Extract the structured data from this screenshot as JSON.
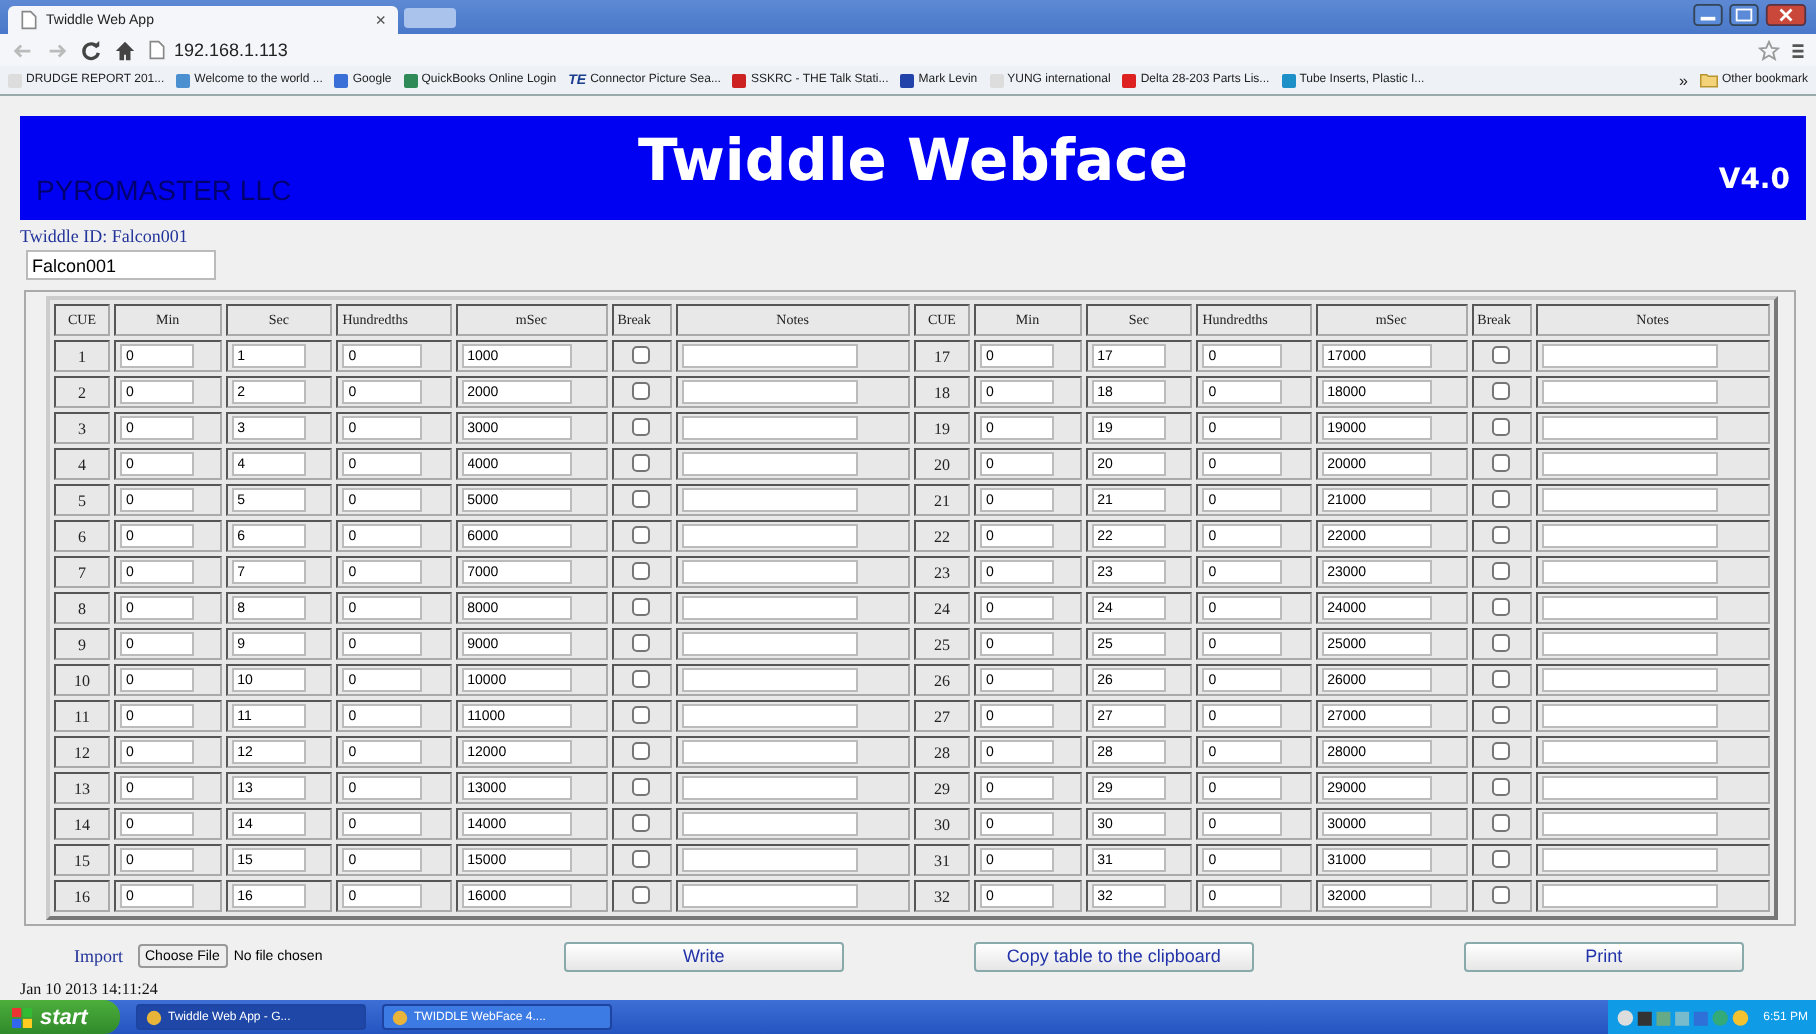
{
  "browser": {
    "tab": {
      "title": "Twiddle Web App",
      "close": "×"
    },
    "address": "192.168.1.113",
    "bookmarks": [
      {
        "label": "DRUDGE REPORT 201...",
        "color": "#dddddd"
      },
      {
        "label": "Welcome to the world ...",
        "color": "#4a8fd0"
      },
      {
        "label": "Google",
        "color": "#3a6fd8"
      },
      {
        "label": "QuickBooks Online Login",
        "color": "#2e8b57"
      },
      {
        "label": "Connector Picture Sea...",
        "color": "#1b3f8f",
        "badge": "TE"
      },
      {
        "label": "SSKRC - THE Talk Stati...",
        "color": "#cc2222"
      },
      {
        "label": "Mark Levin",
        "color": "#2244aa"
      },
      {
        "label": "YUNG international",
        "color": "#dddddd"
      },
      {
        "label": "Delta 28-203 Parts Lis...",
        "color": "#dd2222"
      },
      {
        "label": "Tube Inserts, Plastic I...",
        "color": "#1e90c8"
      }
    ],
    "overflow": "»",
    "other_bookmarks": "Other bookmark"
  },
  "header": {
    "company": "PYROMASTER LLC",
    "title": "Twiddle Webface",
    "version": "V4.0"
  },
  "twiddle_id": {
    "label": "Twiddle ID: Falcon001",
    "value": "Falcon001"
  },
  "table": {
    "halves": [
      {
        "columns": [
          "CUE",
          "Min",
          "Sec",
          "Hundredths",
          "mSec",
          "Break",
          "Notes"
        ],
        "cues": [
          {
            "cue": "1",
            "min": "0",
            "sec": "1",
            "hundredths": "0",
            "msec": "1000",
            "break": false
          },
          {
            "cue": "2",
            "min": "0",
            "sec": "2",
            "hundredths": "0",
            "msec": "2000",
            "break": false
          },
          {
            "cue": "3",
            "min": "0",
            "sec": "3",
            "hundredths": "0",
            "msec": "3000",
            "break": false
          },
          {
            "cue": "4",
            "min": "0",
            "sec": "4",
            "hundredths": "0",
            "msec": "4000",
            "break": false
          },
          {
            "cue": "5",
            "min": "0",
            "sec": "5",
            "hundredths": "0",
            "msec": "5000",
            "break": false
          },
          {
            "cue": "6",
            "min": "0",
            "sec": "6",
            "hundredths": "0",
            "msec": "6000",
            "break": false
          },
          {
            "cue": "7",
            "min": "0",
            "sec": "7",
            "hundredths": "0",
            "msec": "7000",
            "break": false
          },
          {
            "cue": "8",
            "min": "0",
            "sec": "8",
            "hundredths": "0",
            "msec": "8000",
            "break": false
          },
          {
            "cue": "9",
            "min": "0",
            "sec": "9",
            "hundredths": "0",
            "msec": "9000",
            "break": false
          },
          {
            "cue": "10",
            "min": "0",
            "sec": "10",
            "hundredths": "0",
            "msec": "10000",
            "break": false
          },
          {
            "cue": "11",
            "min": "0",
            "sec": "11",
            "hundredths": "0",
            "msec": "11000",
            "break": false
          },
          {
            "cue": "12",
            "min": "0",
            "sec": "12",
            "hundredths": "0",
            "msec": "12000",
            "break": false
          },
          {
            "cue": "13",
            "min": "0",
            "sec": "13",
            "hundredths": "0",
            "msec": "13000",
            "break": false
          },
          {
            "cue": "14",
            "min": "0",
            "sec": "14",
            "hundredths": "0",
            "msec": "14000",
            "break": false
          },
          {
            "cue": "15",
            "min": "0",
            "sec": "15",
            "hundredths": "0",
            "msec": "15000",
            "break": false
          },
          {
            "cue": "16",
            "min": "0",
            "sec": "16",
            "hundredths": "0",
            "msec": "16000",
            "break": false
          }
        ]
      },
      {
        "columns": [
          "CUE",
          "Min",
          "Sec",
          "Hundredths",
          "mSec",
          "Break",
          "Notes"
        ],
        "cues": [
          {
            "cue": "17",
            "min": "0",
            "sec": "17",
            "hundredths": "0",
            "msec": "17000",
            "break": false
          },
          {
            "cue": "18",
            "min": "0",
            "sec": "18",
            "hundredths": "0",
            "msec": "18000",
            "break": false
          },
          {
            "cue": "19",
            "min": "0",
            "sec": "19",
            "hundredths": "0",
            "msec": "19000",
            "break": false
          },
          {
            "cue": "20",
            "min": "0",
            "sec": "20",
            "hundredths": "0",
            "msec": "20000",
            "break": false
          },
          {
            "cue": "21",
            "min": "0",
            "sec": "21",
            "hundredths": "0",
            "msec": "21000",
            "break": false
          },
          {
            "cue": "22",
            "min": "0",
            "sec": "22",
            "hundredths": "0",
            "msec": "22000",
            "break": false
          },
          {
            "cue": "23",
            "min": "0",
            "sec": "23",
            "hundredths": "0",
            "msec": "23000",
            "break": false
          },
          {
            "cue": "24",
            "min": "0",
            "sec": "24",
            "hundredths": "0",
            "msec": "24000",
            "break": false
          },
          {
            "cue": "25",
            "min": "0",
            "sec": "25",
            "hundredths": "0",
            "msec": "25000",
            "break": false
          },
          {
            "cue": "26",
            "min": "0",
            "sec": "26",
            "hundredths": "0",
            "msec": "26000",
            "break": false
          },
          {
            "cue": "27",
            "min": "0",
            "sec": "27",
            "hundredths": "0",
            "msec": "27000",
            "break": false
          },
          {
            "cue": "28",
            "min": "0",
            "sec": "28",
            "hundredths": "0",
            "msec": "28000",
            "break": false
          },
          {
            "cue": "29",
            "min": "0",
            "sec": "29",
            "hundredths": "0",
            "msec": "29000",
            "break": false
          },
          {
            "cue": "30",
            "min": "0",
            "sec": "30",
            "hundredths": "0",
            "msec": "30000",
            "break": false
          },
          {
            "cue": "31",
            "min": "0",
            "sec": "31",
            "hundredths": "0",
            "msec": "31000",
            "break": false
          },
          {
            "cue": "32",
            "min": "0",
            "sec": "32",
            "hundredths": "0",
            "msec": "32000",
            "break": false
          }
        ]
      }
    ]
  },
  "import": {
    "label": "Import",
    "button": "Choose File",
    "status": "No file chosen"
  },
  "buttons": [
    "Write",
    "Copy table to the clipboard",
    "Print"
  ],
  "timestamp": "Jan 10 2013 14:11:24",
  "taskbar": {
    "start": "start",
    "tasks": [
      {
        "label": "Twiddle Web App - G...",
        "selected": true
      },
      {
        "label": "TWIDDLE WebFace 4....",
        "selected": false
      }
    ],
    "clock": "6:51 PM"
  }
}
